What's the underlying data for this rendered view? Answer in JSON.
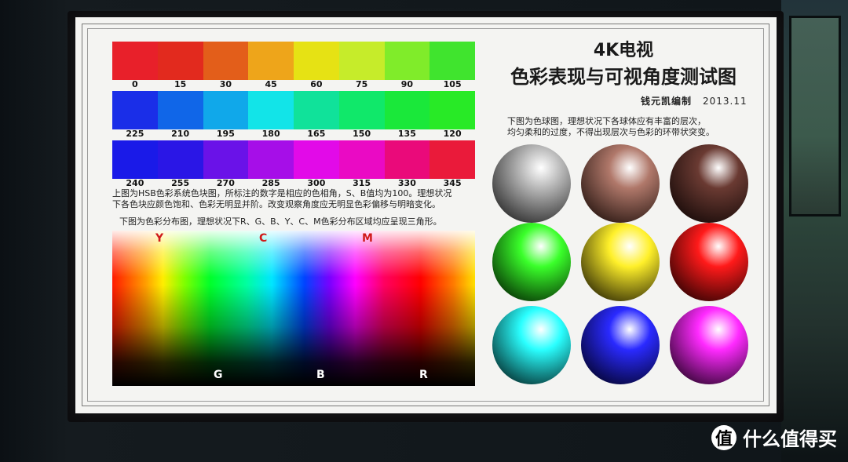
{
  "title": {
    "line1": "4K电视",
    "line2": "色彩表现与可视角度测试图"
  },
  "author": {
    "name": "钱元凯编制",
    "date": "2013.11"
  },
  "hue_rows": [
    {
      "colors": [
        "#e8202a",
        "#e22a1e",
        "#e35e1a",
        "#eea51a",
        "#e6e214",
        "#c6ec2a",
        "#80ec2a",
        "#40e42e"
      ],
      "labels": [
        "0",
        "15",
        "30",
        "45",
        "60",
        "75",
        "90",
        "105"
      ]
    },
    {
      "colors": [
        "#1a2ee8",
        "#1066e8",
        "#10a8ea",
        "#12e4e8",
        "#10e29a",
        "#10e86a",
        "#1ae83a",
        "#28ea26"
      ],
      "labels": [
        "225",
        "210",
        "195",
        "180",
        "165",
        "150",
        "135",
        "120"
      ]
    },
    {
      "colors": [
        "#1a1ae8",
        "#2a16e6",
        "#6a12e8",
        "#a60ee8",
        "#e20ae8",
        "#ea0ac4",
        "#ea0a7a",
        "#ea1a3a"
      ],
      "labels": [
        "240",
        "255",
        "270",
        "285",
        "300",
        "315",
        "330",
        "345"
      ]
    }
  ],
  "hsb_description": {
    "line1": "上图为HSB色彩系统色块图，所标注的数字是相应的色相角，S、B值均为100。理想状况",
    "line2": "下各色块应颜色饱和、色彩无明显并阶。改变观察角度应无明显色彩偏移与明暗变化。"
  },
  "distribution": {
    "caption": "下图为色彩分布图，理想状况下R、G、B、Y、C、M色彩分布区域均应呈现三角形。",
    "top_labels": [
      "Y",
      "C",
      "M"
    ],
    "bottom_labels": [
      "G",
      "B",
      "R"
    ],
    "top_label_color": "#d01a1a",
    "bottom_label_color": "#ffffff"
  },
  "sphere_description": {
    "line1": "下图为色球图，理想状况下各球体应有丰富的层次，",
    "line2": "均匀柔和的过度，不得出现层次与色彩的环带状突变。"
  },
  "spheres": [
    {
      "name": "gray",
      "color": "#b8b8b8",
      "dark": "#1a1a1a"
    },
    {
      "name": "skin",
      "color": "#b0786a",
      "dark": "#1a0c08"
    },
    {
      "name": "brown",
      "color": "#6a3a32",
      "dark": "#0e0504"
    },
    {
      "name": "green",
      "color": "#3aff2a",
      "dark": "#001a00"
    },
    {
      "name": "yellow",
      "color": "#fff02a",
      "dark": "#1a1600"
    },
    {
      "name": "red",
      "color": "#ff1a1a",
      "dark": "#1a0000"
    },
    {
      "name": "cyan",
      "color": "#2affff",
      "dark": "#001a1a"
    },
    {
      "name": "blue",
      "color": "#2a2aff",
      "dark": "#00001a"
    },
    {
      "name": "magenta",
      "color": "#ff2aff",
      "dark": "#1a001a"
    }
  ],
  "watermark": {
    "icon": "值",
    "text": "什么值得买"
  }
}
